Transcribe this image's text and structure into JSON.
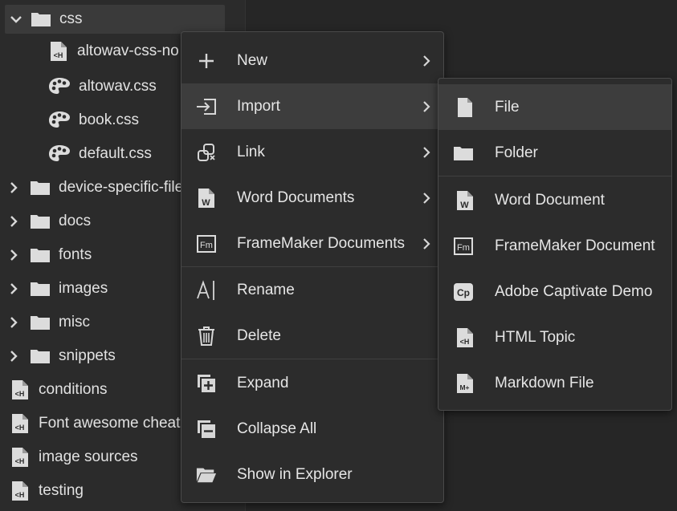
{
  "tree": {
    "rows": [
      {
        "label": "css",
        "kind": "folder",
        "expanded": true
      },
      {
        "label": "altowav-css-no",
        "kind": "html-file"
      },
      {
        "label": "altowav.css",
        "kind": "css-file"
      },
      {
        "label": "book.css",
        "kind": "css-file"
      },
      {
        "label": "default.css",
        "kind": "css-file"
      },
      {
        "label": "device-specific-file",
        "kind": "folder"
      },
      {
        "label": "docs",
        "kind": "folder"
      },
      {
        "label": "fonts",
        "kind": "folder"
      },
      {
        "label": "images",
        "kind": "folder"
      },
      {
        "label": "misc",
        "kind": "folder"
      },
      {
        "label": "snippets",
        "kind": "folder"
      },
      {
        "label": "conditions",
        "kind": "html-file"
      },
      {
        "label": "Font awesome cheat",
        "kind": "html-file"
      },
      {
        "label": "image sources",
        "kind": "html-file"
      },
      {
        "label": "testing",
        "kind": "html-file"
      }
    ]
  },
  "context_menu": {
    "items": [
      {
        "label": "New",
        "icon": "plus-icon",
        "submenu": true
      },
      {
        "label": "Import",
        "icon": "import-icon",
        "submenu": true,
        "highlighted": true
      },
      {
        "label": "Link",
        "icon": "link-icon",
        "submenu": true
      },
      {
        "label": "Word Documents",
        "icon": "word-doc-icon",
        "submenu": true
      },
      {
        "label": "FrameMaker Documents",
        "icon": "framemaker-icon",
        "submenu": true
      },
      {
        "label": "Rename",
        "icon": "rename-icon"
      },
      {
        "label": "Delete",
        "icon": "trash-icon"
      },
      {
        "label": "Expand",
        "icon": "expand-icon"
      },
      {
        "label": "Collapse All",
        "icon": "collapse-all-icon"
      },
      {
        "label": "Show in Explorer",
        "icon": "folder-open-icon"
      }
    ]
  },
  "import_submenu": {
    "items": [
      {
        "label": "File",
        "icon": "file-icon",
        "highlighted": true
      },
      {
        "label": "Folder",
        "icon": "folder-icon"
      },
      {
        "label": "Word Document",
        "icon": "word-doc-icon"
      },
      {
        "label": "FrameMaker Document",
        "icon": "framemaker-icon"
      },
      {
        "label": "Adobe Captivate Demo",
        "icon": "captivate-icon"
      },
      {
        "label": "HTML Topic",
        "icon": "html-topic-icon"
      },
      {
        "label": "Markdown File",
        "icon": "markdown-icon"
      }
    ]
  },
  "icon_glyphs": {
    "word": "W",
    "framemaker": "Fm",
    "captivate": "Cp",
    "markdown": "M+"
  },
  "colors": {
    "background": "#252525",
    "menu_bg": "#2c2c2c",
    "highlight": "#3d3d3d",
    "text": "#e6e6e6",
    "icon": "#cfcfcf"
  }
}
